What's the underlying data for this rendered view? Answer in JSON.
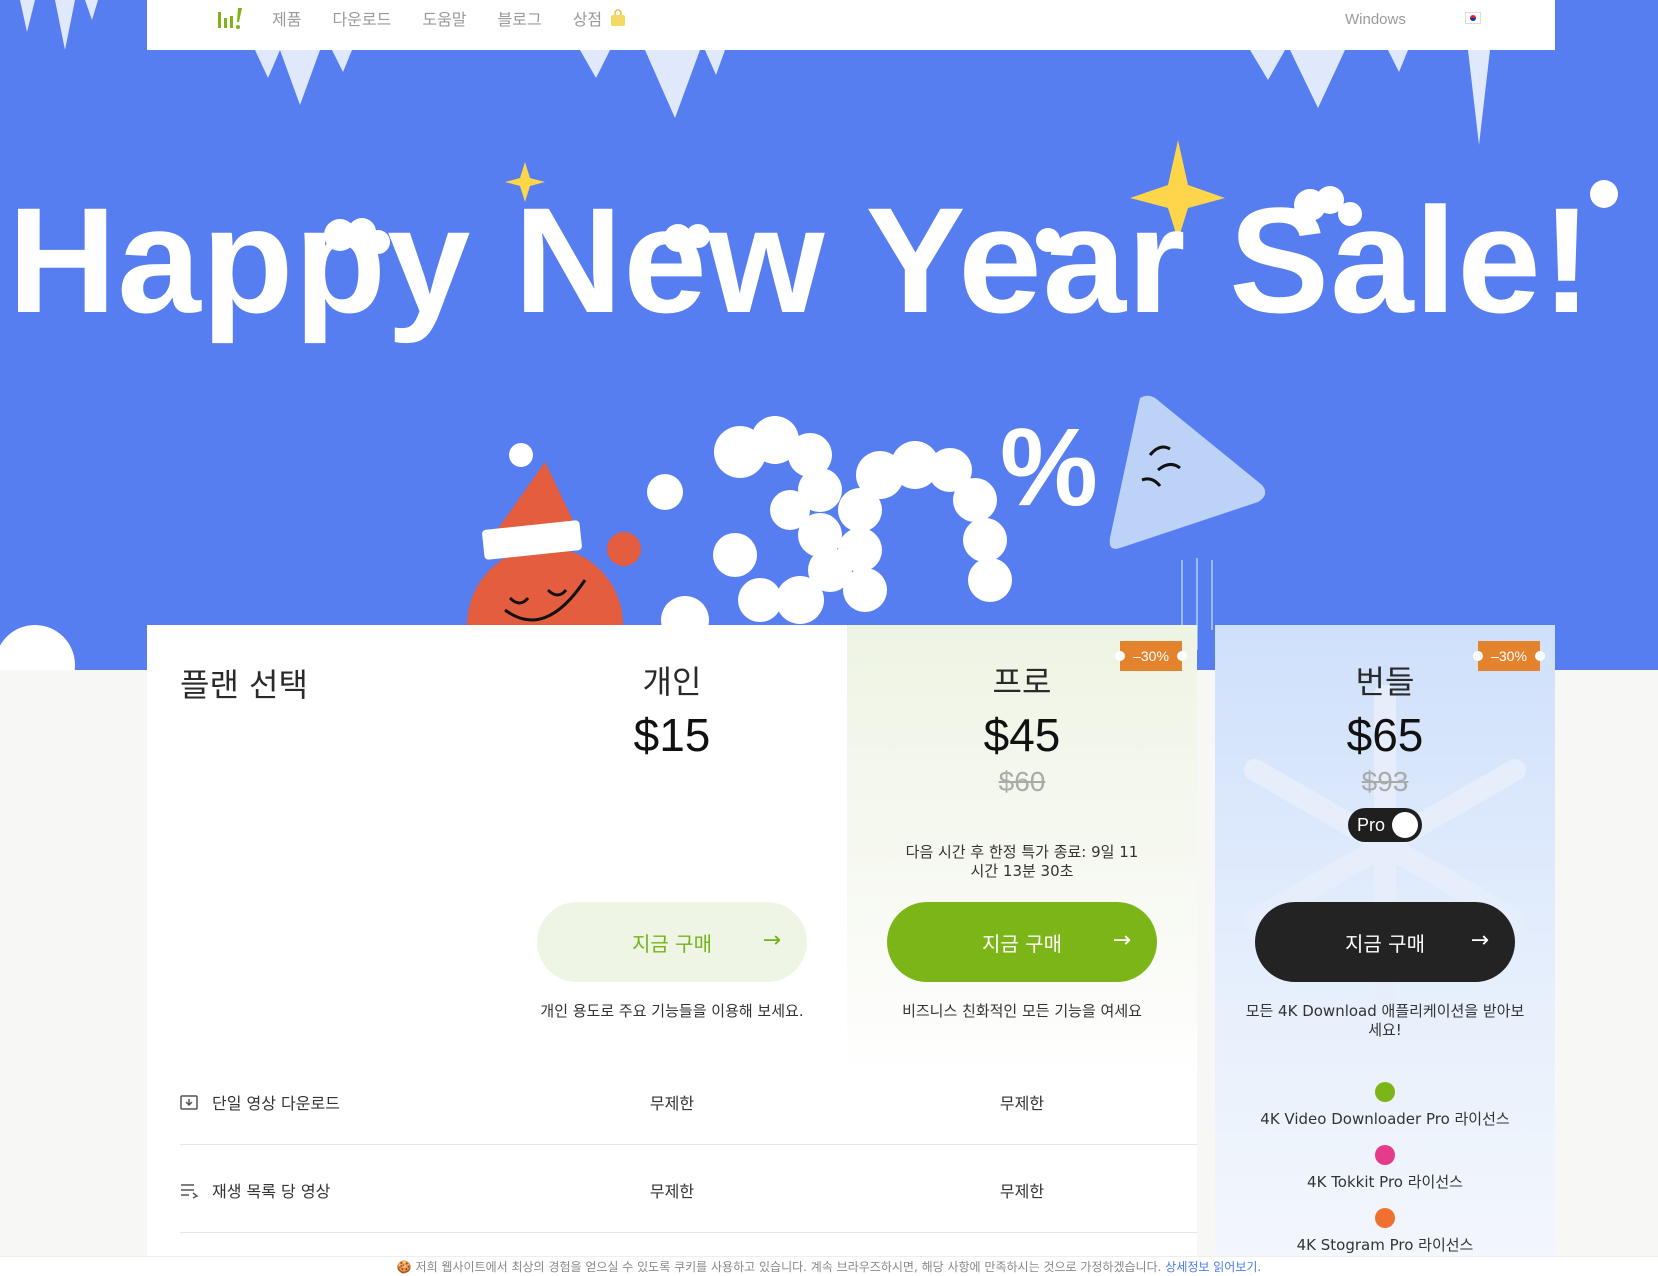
{
  "nav": {
    "items": [
      "제품",
      "다운로드",
      "도움말",
      "블로그",
      "상점"
    ],
    "os": "Windows"
  },
  "hero": {
    "title": "Happy New Year Sale!",
    "percent": "%"
  },
  "plans": {
    "title": "플랜 선택",
    "personal": {
      "name": "개인",
      "price": "$15",
      "button": "지금 구매",
      "desc": "개인 용도로 주요 기능들을 이용해 보세요."
    },
    "pro": {
      "name": "프로",
      "price": "$45",
      "old_price": "$60",
      "badge": "–30%",
      "timer": "다음 시간 후 한정 특가 종료: 9일 11시간 13분 30초",
      "button": "지금 구매",
      "desc": "비즈니스 친화적인 모든 기능을 여세요"
    },
    "bundle": {
      "name": "번들",
      "price": "$65",
      "old_price": "$93",
      "badge": "–30%",
      "toggle_label": "Pro",
      "button": "지금 구매",
      "desc": "모든 4K Download 애플리케이션을 받아보세요!",
      "items": [
        "4K Video Downloader Pro 라이선스",
        "4K Tokkit Pro 라이선스",
        "4K Stogram Pro 라이선스"
      ]
    }
  },
  "features": [
    {
      "label": "단일 영상 다운로드",
      "personal": "무제한",
      "pro": "무제한"
    },
    {
      "label": "재생 목록 당 영상",
      "personal": "무제한",
      "pro": "무제한"
    }
  ],
  "cookie": {
    "text": "저희 웹사이트에서 최상의 경험을 얻으실 수 있도록 쿠키를 사용하고 있습니다. 계속 브라우즈하시면, 해당 사항에 만족하시는 것으로 가정하겠습니다.",
    "link": "상세정보 읽어보기."
  },
  "colors": {
    "hero_bg": "#567ef0",
    "accent_green": "#7cb517",
    "badge_orange": "#e4832d"
  }
}
